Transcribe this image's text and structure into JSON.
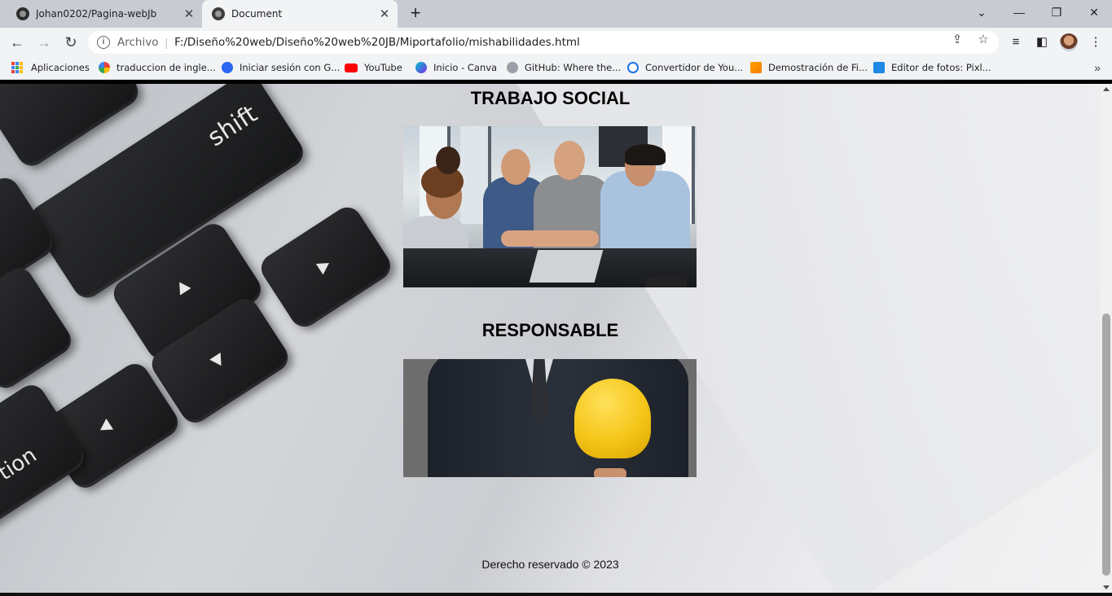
{
  "browser": {
    "tabs": [
      {
        "title": "Johan0202/Pagina-webJb",
        "active": false,
        "icon": "github-icon"
      },
      {
        "title": "Document",
        "active": true,
        "icon": "globe-icon"
      }
    ],
    "new_tab": "+",
    "window_controls": {
      "dropdown": "⌄",
      "minimize": "—",
      "restore": "❐",
      "close": "✕"
    },
    "nav": {
      "back": "←",
      "forward": "→",
      "reload": "↻"
    },
    "address": {
      "scheme_label": "Archivo",
      "url": "F:/Diseño%20web/Diseño%20web%20JB/Miportafolio/mishabilidades.html"
    },
    "bookmarks": [
      {
        "label": "Aplicaciones",
        "icon": "apps-grid-icon"
      },
      {
        "label": "traduccion de ingle...",
        "icon": "google-icon"
      },
      {
        "label": "Iniciar sesión con G...",
        "icon": "zoho-icon"
      },
      {
        "label": "YouTube",
        "icon": "youtube-icon"
      },
      {
        "label": "Inicio - Canva",
        "icon": "canva-icon"
      },
      {
        "label": "GitHub: Where the...",
        "icon": "github-icon"
      },
      {
        "label": "Convertidor de You...",
        "icon": "download-icon"
      },
      {
        "label": "Demostración de Fi...",
        "icon": "firebase-icon"
      },
      {
        "label": "Editor de fotos: Pixl...",
        "icon": "pixlr-icon"
      }
    ],
    "bookmarks_more": "»"
  },
  "page": {
    "sections": [
      {
        "heading": "TRABAJO SOCIAL",
        "image": "team-hands-photo"
      },
      {
        "heading": "RESPONSABLE",
        "image": "businessman-helmet-photo"
      }
    ],
    "background_image": "laptop-keyboard-photo",
    "key_labels": {
      "shift": "shift",
      "option": "tion"
    },
    "footer": "Derecho reservado © 2023"
  },
  "colors": {
    "tabstrip": "#c8cbd2",
    "toolbar": "#f1f3f4",
    "heading_text": "#000000",
    "helmet": "#f5c518"
  }
}
